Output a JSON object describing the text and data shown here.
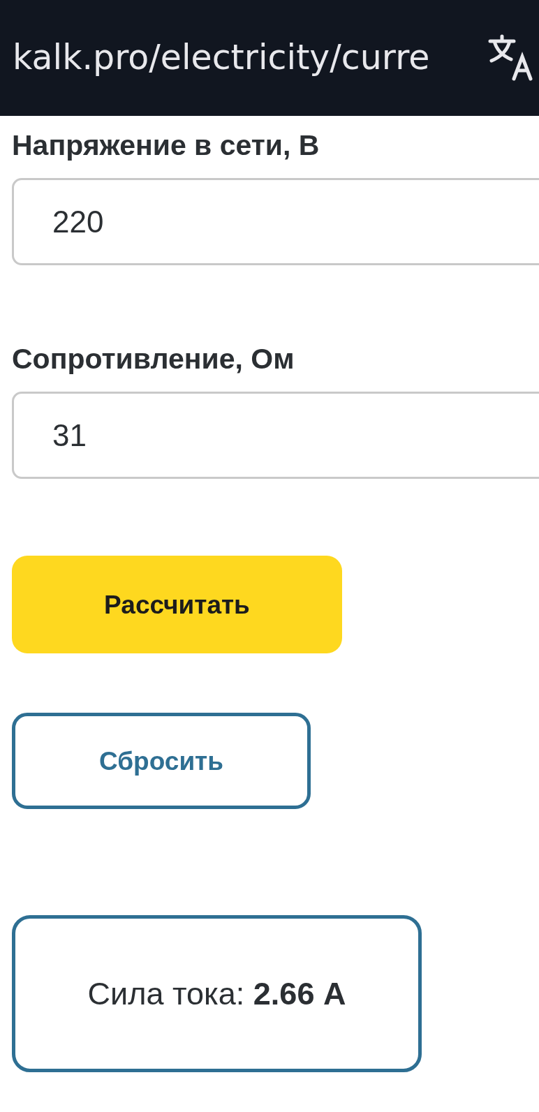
{
  "address_bar": {
    "url": "kalk.pro/electricity/curre"
  },
  "fields": [
    {
      "label": "Напряжение в сети, В",
      "value": "220"
    },
    {
      "label": "Сопротивление, Ом",
      "value": "31"
    }
  ],
  "buttons": [
    {
      "kind": "primary",
      "label": "Рассчитать"
    },
    {
      "kind": "outline",
      "label": "Сбросить"
    }
  ],
  "result": {
    "text": "Сила тока: **2.66 А**"
  }
}
